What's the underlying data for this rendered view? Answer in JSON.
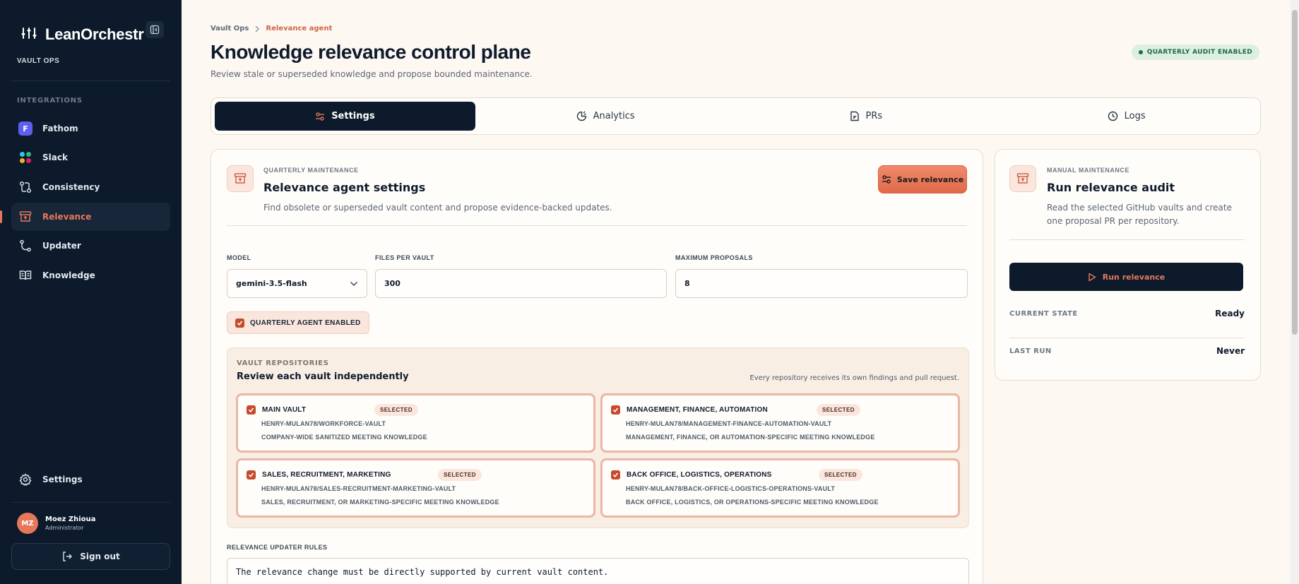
{
  "app": {
    "name": "LeanOrchestr",
    "workspace": "VAULT OPS"
  },
  "sidebar": {
    "section": "INTEGRATIONS",
    "items": [
      {
        "label": "Fathom",
        "icon": "fathom-icon"
      },
      {
        "label": "Slack",
        "icon": "slack-icon"
      },
      {
        "label": "Consistency",
        "icon": "consistency-icon"
      },
      {
        "label": "Relevance",
        "icon": "archive-icon",
        "active": true
      },
      {
        "label": "Updater",
        "icon": "git-branch-icon"
      },
      {
        "label": "Knowledge",
        "icon": "book-icon"
      }
    ],
    "settings_label": "Settings",
    "user": {
      "initials": "MZ",
      "name": "Moez Zhioua",
      "role": "Administrator"
    },
    "signout_label": "Sign out"
  },
  "header": {
    "breadcrumb": [
      "Vault Ops",
      "Relevance agent"
    ],
    "title": "Knowledge relevance control plane",
    "subtitle": "Review stale or superseded knowledge and propose bounded maintenance.",
    "badge": "QUARTERLY AUDIT ENABLED"
  },
  "tabs": [
    {
      "label": "Settings",
      "icon": "sliders-icon",
      "active": true
    },
    {
      "label": "Analytics",
      "icon": "analytics-icon"
    },
    {
      "label": "PRs",
      "icon": "file-diff-icon"
    },
    {
      "label": "Logs",
      "icon": "clock-icon"
    }
  ],
  "settings_card": {
    "eyebrow": "QUARTERLY MAINTENANCE",
    "title": "Relevance agent settings",
    "description": "Find obsolete or superseded vault content and propose evidence-backed updates.",
    "save_label": "Save relevance",
    "model_label": "MODEL",
    "model_value": "gemini-3.5-flash",
    "files_label": "FILES PER VAULT",
    "files_value": "300",
    "proposals_label": "MAXIMUM PROPOSALS",
    "proposals_value": "8",
    "quarterly_label": "QUARTERLY AGENT ENABLED",
    "repos": {
      "eyebrow": "VAULT REPOSITORIES",
      "title": "Review each vault independently",
      "note": "Every repository receives its own findings and pull request.",
      "selected_label": "SELECTED",
      "items": [
        {
          "name": "MAIN VAULT",
          "path": "HENRY-MULAN78/WORKFORCE-VAULT",
          "desc": "COMPANY-WIDE SANITIZED MEETING KNOWLEDGE"
        },
        {
          "name": "MANAGEMENT, FINANCE, AUTOMATION",
          "path": "HENRY-MULAN78/MANAGEMENT-FINANCE-AUTOMATION-VAULT",
          "desc": "MANAGEMENT, FINANCE, OR AUTOMATION-SPECIFIC MEETING KNOWLEDGE"
        },
        {
          "name": "SALES, RECRUITMENT, MARKETING",
          "path": "HENRY-MULAN78/SALES-RECRUITMENT-MARKETING-VAULT",
          "desc": "SALES, RECRUITMENT, OR MARKETING-SPECIFIC MEETING KNOWLEDGE"
        },
        {
          "name": "BACK OFFICE, LOGISTICS, OPERATIONS",
          "path": "HENRY-MULAN78/BACK-OFFICE-LOGISTICS-OPERATIONS-VAULT",
          "desc": "BACK OFFICE, LOGISTICS, OR OPERATIONS-SPECIFIC MEETING KNOWLEDGE"
        }
      ]
    },
    "rules_label": "RELEVANCE UPDATER RULES",
    "rules_text": "The relevance change must be directly supported by current vault content."
  },
  "audit_card": {
    "eyebrow": "MANUAL MAINTENANCE",
    "title": "Run relevance audit",
    "description": "Read the selected GitHub vaults and create one proposal PR per repository.",
    "run_label": "Run relevance",
    "state_label": "CURRENT STATE",
    "state_value": "Ready",
    "last_label": "LAST RUN",
    "last_value": "Never"
  },
  "colors": {
    "sidebar": "#0c1a2b",
    "accent": "#e6785a",
    "background": "#fdf8f2",
    "success": "#1f6b43"
  }
}
